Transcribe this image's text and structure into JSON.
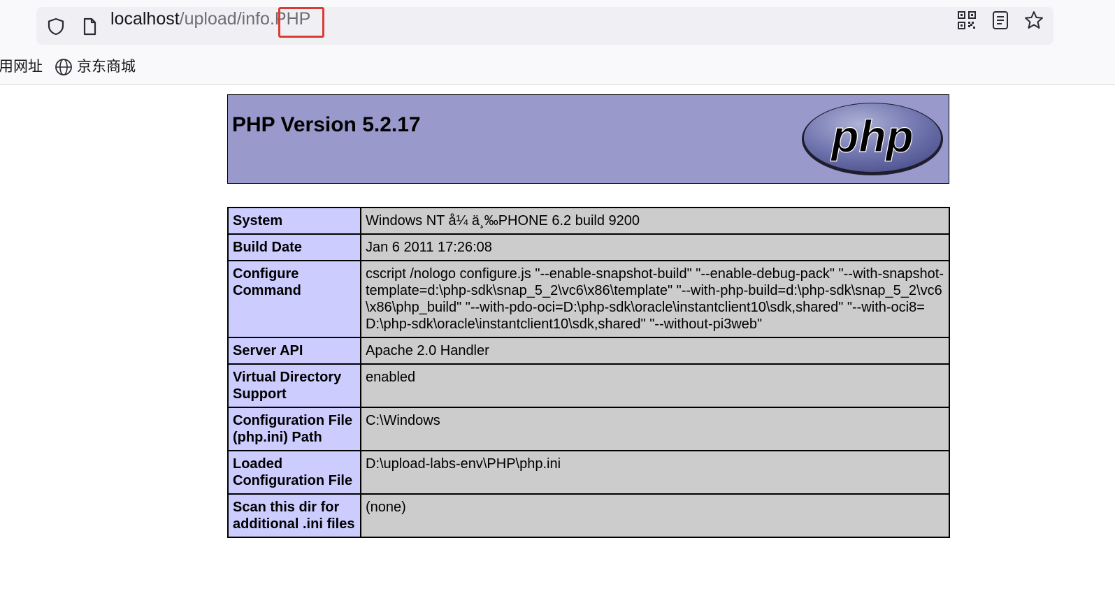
{
  "browser": {
    "url": {
      "host": "localhost",
      "path": "/upload/info.PHP"
    },
    "bookmarks": [
      {
        "label": "用网址"
      },
      {
        "label": "京东商城"
      }
    ]
  },
  "php_header": {
    "title": "PHP Version 5.2.17",
    "logo_text": "php"
  },
  "info_rows": [
    {
      "key": "System",
      "value": "Windows NT å¼ ä¸‰PHONE 6.2 build 9200"
    },
    {
      "key": "Build Date",
      "value": "Jan 6 2011 17:26:08"
    },
    {
      "key": "Configure Command",
      "value": "cscript /nologo configure.js \"--enable-snapshot-build\" \"--enable-debug-pack\" \"--with-snapshot-template=d:\\php-sdk\\snap_5_2\\vc6\\x86\\template\" \"--with-php-build=d:\\php-sdk\\snap_5_2\\vc6\\x86\\php_build\" \"--with-pdo-oci=D:\\php-sdk\\oracle\\instantclient10\\sdk,shared\" \"--with-oci8=D:\\php-sdk\\oracle\\instantclient10\\sdk,shared\" \"--without-pi3web\""
    },
    {
      "key": "Server API",
      "value": "Apache 2.0 Handler"
    },
    {
      "key": "Virtual Directory Support",
      "value": "enabled"
    },
    {
      "key": "Configuration File (php.ini) Path",
      "value": "C:\\Windows"
    },
    {
      "key": "Loaded Configuration File",
      "value": "D:\\upload-labs-env\\PHP\\php.ini"
    },
    {
      "key": "Scan this dir for additional .ini files",
      "value": "(none)"
    }
  ],
  "colors": {
    "header_bg": "#9999cc",
    "key_bg": "#ccccff",
    "value_bg": "#cccccc",
    "highlight_box": "#d93a32"
  }
}
